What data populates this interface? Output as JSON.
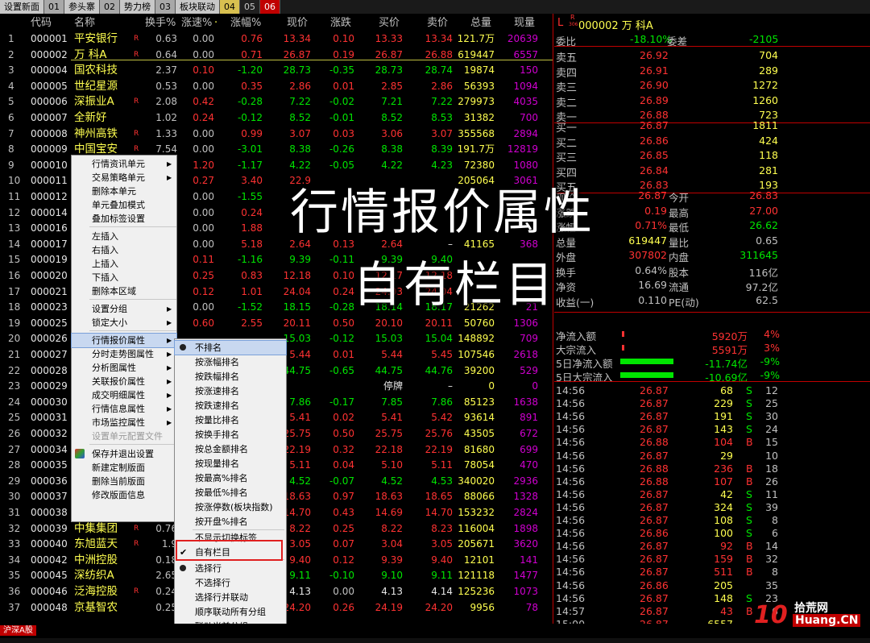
{
  "tabs": [
    "设置新面",
    "01",
    "参头寨",
    "02",
    "势力榜",
    "03",
    "板块联动",
    "04",
    "05",
    "06"
  ],
  "headers": {
    "code": "代码",
    "name": "名称",
    "hs": "换手%",
    "zs": "涨速%",
    "zf": "涨幅%",
    "xj": "现价",
    "zd": "涨跌",
    "mr": "买价",
    "mc": "卖价",
    "zl": "总量",
    "xl": "现量",
    "dot": "·"
  },
  "rows": [
    [
      "1",
      "000001",
      "平安银行",
      "R",
      "0.63",
      "0.00",
      "0.76",
      "13.34",
      "0.10",
      "13.33",
      "13.34",
      "121.7万",
      "20639",
      "r"
    ],
    [
      "2",
      "000002",
      "万 科A",
      "R",
      "0.64",
      "0.00",
      "0.71",
      "26.87",
      "0.19",
      "26.87",
      "26.88",
      "619447",
      "6557",
      "r"
    ],
    [
      "3",
      "000004",
      "国农科技",
      "",
      "2.37",
      "0.10",
      "-1.20",
      "28.73",
      "-0.35",
      "28.73",
      "28.74",
      "19874",
      "150",
      "g"
    ],
    [
      "4",
      "000005",
      "世纪星源",
      "",
      "0.53",
      "0.00",
      "0.35",
      "2.86",
      "0.01",
      "2.85",
      "2.86",
      "56393",
      "1094",
      "r"
    ],
    [
      "5",
      "000006",
      "深振业A",
      "R",
      "2.08",
      "0.42",
      "-0.28",
      "7.22",
      "-0.02",
      "7.21",
      "7.22",
      "279973",
      "4035",
      "g"
    ],
    [
      "6",
      "000007",
      "全新好",
      "",
      "1.02",
      "0.24",
      "-0.12",
      "8.52",
      "-0.01",
      "8.52",
      "8.53",
      "31382",
      "700",
      "g"
    ],
    [
      "7",
      "000008",
      "神州高铁",
      "R",
      "1.33",
      "0.00",
      "0.99",
      "3.07",
      "0.03",
      "3.06",
      "3.07",
      "355568",
      "2894",
      "r"
    ],
    [
      "8",
      "000009",
      "中国宝安",
      "R",
      "7.54",
      "0.00",
      "-3.01",
      "8.38",
      "-0.26",
      "8.38",
      "8.39",
      "191.7万",
      "12819",
      "g"
    ],
    [
      "9",
      "000010",
      "",
      "",
      "",
      "1.20",
      "-1.17",
      "4.22",
      "-0.05",
      "4.22",
      "4.23",
      "72380",
      "1080",
      "g"
    ],
    [
      "10",
      "000011",
      "",
      "",
      "",
      "0.27",
      "3.40",
      "22.9",
      "",
      "",
      "",
      "205064",
      "3061",
      "r"
    ],
    [
      "11",
      "000012",
      "",
      "",
      "",
      "0.00",
      "-1.55",
      "",
      "",
      "",
      "",
      "",
      "",
      "g"
    ],
    [
      "12",
      "000014",
      "",
      "",
      "",
      "0.00",
      "0.24",
      "",
      "",
      "",
      "",
      "",
      "",
      "r"
    ],
    [
      "13",
      "000016",
      "",
      "",
      "",
      "0.00",
      "1.88",
      "",
      "",
      "",
      "",
      "",
      "",
      "r"
    ],
    [
      "14",
      "000017",
      "",
      "",
      "",
      "0.00",
      "5.18",
      "2.64",
      "0.13",
      "2.64",
      "–",
      "41165",
      "368",
      "r"
    ],
    [
      "15",
      "000019",
      "",
      "",
      "",
      "0.11",
      "-1.16",
      "9.39",
      "-0.11",
      "9.39",
      "9.40",
      "",
      "",
      "g"
    ],
    [
      "16",
      "000020",
      "",
      "",
      "",
      "0.25",
      "0.83",
      "12.18",
      "0.10",
      "12.17",
      "12.18",
      "",
      "",
      "r"
    ],
    [
      "17",
      "000021",
      "",
      "",
      "",
      "0.12",
      "1.01",
      "24.04",
      "0.24",
      "24.03",
      "24.04",
      "",
      "",
      "r"
    ],
    [
      "18",
      "000023",
      "",
      "",
      "",
      "0.00",
      "-1.52",
      "18.15",
      "-0.28",
      "18.14",
      "18.17",
      "21262",
      "21",
      "g"
    ],
    [
      "19",
      "000025",
      "",
      "",
      "",
      "0.60",
      "2.55",
      "20.11",
      "0.50",
      "20.10",
      "20.11",
      "50760",
      "1306",
      "r"
    ],
    [
      "20",
      "000026",
      "",
      "",
      "",
      "",
      "",
      "15.03",
      "-0.12",
      "15.03",
      "15.04",
      "148892",
      "709",
      "g"
    ],
    [
      "21",
      "000027",
      "",
      "",
      "",
      "",
      "",
      "5.44",
      "0.01",
      "5.44",
      "5.45",
      "107546",
      "2618",
      "r"
    ],
    [
      "22",
      "000028",
      "",
      "",
      "",
      "",
      "",
      "44.75",
      "-0.65",
      "44.75",
      "44.76",
      "39200",
      "529",
      "g"
    ],
    [
      "23",
      "000029",
      "",
      "",
      "",
      "",
      "",
      "",
      "",
      "停牌",
      "–",
      "0",
      "0",
      "w"
    ],
    [
      "24",
      "000030",
      "",
      "",
      "",
      "",
      "",
      "7.86",
      "-0.17",
      "7.85",
      "7.86",
      "85123",
      "1638",
      "g"
    ],
    [
      "25",
      "000031",
      "",
      "",
      "",
      "",
      "",
      "5.41",
      "0.02",
      "5.41",
      "5.42",
      "93614",
      "891",
      "r"
    ],
    [
      "26",
      "000032",
      "",
      "",
      "",
      "",
      "",
      "25.75",
      "0.50",
      "25.75",
      "25.76",
      "43505",
      "672",
      "r"
    ],
    [
      "27",
      "000034",
      "",
      "",
      "",
      "",
      "",
      "22.19",
      "0.32",
      "22.18",
      "22.19",
      "81680",
      "699",
      "r"
    ],
    [
      "28",
      "000035",
      "",
      "",
      "",
      "",
      "",
      "5.11",
      "0.04",
      "5.10",
      "5.11",
      "78054",
      "470",
      "r"
    ],
    [
      "29",
      "000036",
      "",
      "",
      "",
      "",
      "",
      "4.52",
      "-0.07",
      "4.52",
      "4.53",
      "340020",
      "2936",
      "g"
    ],
    [
      "30",
      "000037",
      "",
      "",
      "",
      "",
      "",
      "18.63",
      "0.97",
      "18.63",
      "18.65",
      "88066",
      "1328",
      "r"
    ],
    [
      "31",
      "000038",
      "",
      "",
      "",
      "",
      "",
      "14.70",
      "0.43",
      "14.69",
      "14.70",
      "153232",
      "2824",
      "r"
    ],
    [
      "32",
      "000039",
      "中集集团",
      "R",
      "0.76",
      "",
      "",
      "8.22",
      "0.25",
      "8.22",
      "8.23",
      "116004",
      "1898",
      "r"
    ],
    [
      "33",
      "000040",
      "东旭蓝天",
      "R",
      "1.9",
      "",
      "",
      "3.05",
      "0.07",
      "3.04",
      "3.05",
      "205671",
      "3620",
      "r"
    ],
    [
      "34",
      "000042",
      "中洲控股",
      "",
      "0.18",
      "",
      "",
      "9.40",
      "0.12",
      "9.39",
      "9.40",
      "12101",
      "141",
      "r"
    ],
    [
      "35",
      "000045",
      "深纺织A",
      "",
      "2.65",
      "",
      "",
      "9.11",
      "-0.10",
      "9.10",
      "9.11",
      "121118",
      "1477",
      "g"
    ],
    [
      "36",
      "000046",
      "泛海控股",
      "R",
      "0.24",
      "",
      "",
      "4.13",
      "0.00",
      "4.13",
      "4.14",
      "125236",
      "1073",
      "w"
    ],
    [
      "37",
      "000048",
      "京基智农",
      "",
      "0.25",
      "",
      "",
      "24.20",
      "0.26",
      "24.19",
      "24.20",
      "9956",
      "78",
      "r"
    ]
  ],
  "right": {
    "title": "000002 万 科A",
    "title_prefix": "L",
    "title_sup": "R",
    "title_code_small": "306",
    "wb_label": "委比",
    "wb_val": "-18.10%",
    "wc_label": "委差",
    "wc_val": "-2105",
    "sell": [
      [
        "卖五",
        "26.92",
        "704"
      ],
      [
        "卖四",
        "26.91",
        "289"
      ],
      [
        "卖三",
        "26.90",
        "1272"
      ],
      [
        "卖二",
        "26.89",
        "1260"
      ],
      [
        "卖一",
        "26.88",
        "723"
      ]
    ],
    "buy": [
      [
        "买一",
        "26.87",
        "1811"
      ],
      [
        "买二",
        "26.86",
        "424"
      ],
      [
        "买三",
        "26.85",
        "118"
      ],
      [
        "买四",
        "26.84",
        "281"
      ],
      [
        "买五",
        "26.83",
        "193"
      ]
    ],
    "stats": [
      [
        "现价",
        "26.87",
        "今开",
        "26.83"
      ],
      [
        "涨跌",
        "0.19",
        "最高",
        "27.00"
      ],
      [
        "涨幅",
        "0.71%",
        "最低",
        "26.62"
      ],
      [
        "总量",
        "619447",
        "量比",
        "0.65"
      ],
      [
        "外盘",
        "307802",
        "内盘",
        "311645"
      ],
      [
        "换手",
        "0.64%",
        "股本",
        "116亿"
      ],
      [
        "净资",
        "16.69",
        "流通",
        "97.2亿"
      ],
      [
        "收益(一)",
        "0.110",
        "PE(动)",
        "62.5"
      ]
    ],
    "flow": [
      [
        "净流入额",
        "5920万",
        "4%"
      ],
      [
        "大宗流入",
        "5591万",
        "3%"
      ],
      [
        "5日净流入额",
        "-11.74亿",
        "-9%"
      ],
      [
        "5日大宗流入",
        "-10.69亿",
        "-9%"
      ]
    ],
    "ticks": [
      [
        "14:56",
        "26.87",
        "68",
        "S",
        "12"
      ],
      [
        "14:56",
        "26.87",
        "229",
        "S",
        "25"
      ],
      [
        "14:56",
        "26.87",
        "191",
        "S",
        "30"
      ],
      [
        "14:56",
        "26.87",
        "143",
        "S",
        "24"
      ],
      [
        "14:56",
        "26.88",
        "104",
        "B",
        "15"
      ],
      [
        "14:56",
        "26.87",
        "29",
        "",
        "10"
      ],
      [
        "14:56",
        "26.88",
        "236",
        "B",
        "18"
      ],
      [
        "14:56",
        "26.88",
        "107",
        "B",
        "26"
      ],
      [
        "14:56",
        "26.87",
        "42",
        "S",
        "11"
      ],
      [
        "14:56",
        "26.87",
        "324",
        "S",
        "39"
      ],
      [
        "14:56",
        "26.87",
        "108",
        "S",
        "8"
      ],
      [
        "14:56",
        "26.86",
        "100",
        "S",
        "6"
      ],
      [
        "14:56",
        "26.87",
        "92",
        "B",
        "14"
      ],
      [
        "14:56",
        "26.87",
        "159",
        "B",
        "32"
      ],
      [
        "14:56",
        "26.87",
        "511",
        "B",
        "8"
      ],
      [
        "14:56",
        "26.86",
        "205",
        "",
        "35"
      ],
      [
        "14:56",
        "26.87",
        "148",
        "S",
        "23"
      ],
      [
        "14:57",
        "26.87",
        "43",
        "B",
        "6"
      ],
      [
        "15:00",
        "26.87",
        "6557",
        "",
        ""
      ]
    ]
  },
  "menu1": [
    "行情资讯单元",
    "交易策略单元",
    "删除本单元",
    "单元叠加模式",
    "叠加标签设置",
    "左插入",
    "右插入",
    "上插入",
    "下插入",
    "删除本区域",
    "设置分组",
    "锁定大小",
    "行情报价属性",
    "分时走势图属性",
    "分析图属性",
    "关联报价属性",
    "成交明细属性",
    "行情信息属性",
    "市场监控属性",
    "设置单元配置文件",
    "保存并退出设置",
    "新建定制版面",
    "删除当前版面",
    "修改版面信息"
  ],
  "menu2": [
    "不排名",
    "按涨幅排名",
    "按跌幅排名",
    "按涨速排名",
    "按跌速排名",
    "按量比排名",
    "按换手排名",
    "按总金额排名",
    "按现量排名",
    "按最高%排名",
    "按最低%排名",
    "按涨停数(板块指数)",
    "按开盘%排名",
    "不显示切换标签",
    "自有栏目",
    "选择行",
    "不选择行",
    "选择行并联动",
    "顺序联动所有分组",
    "联动当前分组"
  ],
  "overlay": {
    "line1": "行情报价属性",
    "line2": "自有栏目"
  },
  "bottom_tab": "沪深A股",
  "watermark": {
    "num": "10",
    "text": "拾荒网",
    "domain": "Huang.CN"
  },
  "colors": {
    "up": "#ff3232",
    "down": "#00e600",
    "highlight": "#e02020"
  }
}
